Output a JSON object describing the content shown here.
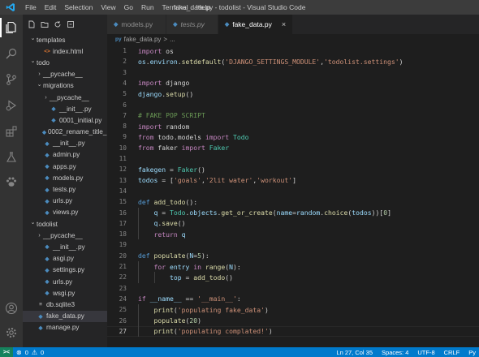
{
  "window": {
    "title": "fake_data.py - todolist - Visual Studio Code",
    "menu": [
      "File",
      "Edit",
      "Selection",
      "View",
      "Go",
      "Run",
      "Terminal",
      "Help"
    ]
  },
  "activity_bar": {
    "top": [
      "explorer-icon",
      "search-icon",
      "source-control-icon",
      "run-debug-icon",
      "extensions-icon",
      "testing-icon",
      "paw-icon"
    ],
    "bottom": [
      "account-icon",
      "settings-gear-icon"
    ]
  },
  "explorer": {
    "items": [
      {
        "label": "templates",
        "kind": "folder",
        "open": true,
        "depth": 1
      },
      {
        "label": "index.html",
        "kind": "html",
        "depth": 2
      },
      {
        "label": "todo",
        "kind": "folder",
        "open": true,
        "depth": 1
      },
      {
        "label": "__pycache__",
        "kind": "folder",
        "open": false,
        "depth": 2
      },
      {
        "label": "migrations",
        "kind": "folder",
        "open": true,
        "depth": 2
      },
      {
        "label": "__pycache__",
        "kind": "folder",
        "open": false,
        "depth": 3
      },
      {
        "label": "__init__.py",
        "kind": "py",
        "depth": 3
      },
      {
        "label": "0001_initial.py",
        "kind": "py",
        "depth": 3
      },
      {
        "label": "0002_rename_title_...",
        "kind": "py",
        "depth": 3
      },
      {
        "label": "__init__.py",
        "kind": "py",
        "depth": 2
      },
      {
        "label": "admin.py",
        "kind": "py",
        "depth": 2
      },
      {
        "label": "apps.py",
        "kind": "py",
        "depth": 2
      },
      {
        "label": "models.py",
        "kind": "py",
        "depth": 2
      },
      {
        "label": "tests.py",
        "kind": "py",
        "depth": 2
      },
      {
        "label": "urls.py",
        "kind": "py",
        "depth": 2
      },
      {
        "label": "views.py",
        "kind": "py",
        "depth": 2
      },
      {
        "label": "todolist",
        "kind": "folder",
        "open": true,
        "depth": 1
      },
      {
        "label": "__pycache__",
        "kind": "folder",
        "open": false,
        "depth": 2
      },
      {
        "label": "__init__.py",
        "kind": "py",
        "depth": 2
      },
      {
        "label": "asgi.py",
        "kind": "py",
        "depth": 2
      },
      {
        "label": "settings.py",
        "kind": "py",
        "depth": 2
      },
      {
        "label": "urls.py",
        "kind": "py",
        "depth": 2
      },
      {
        "label": "wsgi.py",
        "kind": "py",
        "depth": 2
      },
      {
        "label": "db.sqlite3",
        "kind": "db",
        "depth": 1
      },
      {
        "label": "fake_data.py",
        "kind": "py",
        "depth": 1,
        "selected": true
      },
      {
        "label": "manage.py",
        "kind": "py",
        "depth": 1
      }
    ]
  },
  "tabs": [
    {
      "label": "models.py",
      "active": false,
      "italic": false
    },
    {
      "label": "tests.py",
      "active": false,
      "italic": true
    },
    {
      "label": "fake_data.py",
      "active": true,
      "italic": false,
      "close": "×"
    }
  ],
  "breadcrumb": {
    "file": "fake_data.py",
    "sep": ">",
    "rest": "..."
  },
  "editor": {
    "current_line": 27,
    "lines": [
      {
        "n": 1,
        "t": [
          [
            "import",
            "kw"
          ],
          [
            " os",
            "plain"
          ]
        ]
      },
      {
        "n": 2,
        "t": [
          [
            "os",
            "var"
          ],
          [
            ".",
            "plain"
          ],
          [
            "environ",
            "var"
          ],
          [
            ".",
            "plain"
          ],
          [
            "setdefault",
            "fn"
          ],
          [
            "(",
            "plain"
          ],
          [
            "'DJANGO_SETTINGS_MODULE'",
            "str"
          ],
          [
            ",",
            "plain"
          ],
          [
            "'todolist.settings'",
            "str"
          ],
          [
            ")",
            "plain"
          ]
        ]
      },
      {
        "n": 3,
        "t": []
      },
      {
        "n": 4,
        "t": [
          [
            "import",
            "kw"
          ],
          [
            " django",
            "plain"
          ]
        ]
      },
      {
        "n": 5,
        "t": [
          [
            "django",
            "var"
          ],
          [
            ".",
            "plain"
          ],
          [
            "setup",
            "fn"
          ],
          [
            "()",
            "plain"
          ]
        ]
      },
      {
        "n": 6,
        "t": []
      },
      {
        "n": 7,
        "t": [
          [
            "# FAKE POP SCRIPT",
            "cmt"
          ]
        ]
      },
      {
        "n": 8,
        "t": [
          [
            "import",
            "kw"
          ],
          [
            " random",
            "plain"
          ]
        ]
      },
      {
        "n": 9,
        "t": [
          [
            "from",
            "kw"
          ],
          [
            " todo.models ",
            "plain"
          ],
          [
            "import",
            "kw"
          ],
          [
            " ",
            "plain"
          ],
          [
            "Todo",
            "cls"
          ]
        ]
      },
      {
        "n": 10,
        "t": [
          [
            "from",
            "kw"
          ],
          [
            " faker ",
            "plain"
          ],
          [
            "import",
            "kw"
          ],
          [
            " ",
            "plain"
          ],
          [
            "Faker",
            "cls"
          ]
        ]
      },
      {
        "n": 11,
        "t": []
      },
      {
        "n": 12,
        "t": [
          [
            "fakegen",
            "var"
          ],
          [
            " = ",
            "plain"
          ],
          [
            "Faker",
            "cls"
          ],
          [
            "()",
            "plain"
          ]
        ]
      },
      {
        "n": 13,
        "t": [
          [
            "todos",
            "var"
          ],
          [
            " = [",
            "plain"
          ],
          [
            "'goals'",
            "str"
          ],
          [
            ",",
            "plain"
          ],
          [
            "'2lit water'",
            "str"
          ],
          [
            ",",
            "plain"
          ],
          [
            "'workout'",
            "str"
          ],
          [
            "]",
            "plain"
          ]
        ]
      },
      {
        "n": 14,
        "t": []
      },
      {
        "n": 15,
        "t": [
          [
            "def",
            "kwb"
          ],
          [
            " ",
            "plain"
          ],
          [
            "add_todo",
            "fn"
          ],
          [
            "():",
            "plain"
          ]
        ]
      },
      {
        "n": 16,
        "t": [
          [
            "    q",
            "var"
          ],
          [
            " = ",
            "plain"
          ],
          [
            "Todo",
            "cls"
          ],
          [
            ".",
            "plain"
          ],
          [
            "objects",
            "var"
          ],
          [
            ".",
            "plain"
          ],
          [
            "get_or_create",
            "fn"
          ],
          [
            "(",
            "plain"
          ],
          [
            "name",
            "var"
          ],
          [
            "=",
            "plain"
          ],
          [
            "random",
            "var"
          ],
          [
            ".",
            "plain"
          ],
          [
            "choice",
            "fn"
          ],
          [
            "(",
            "plain"
          ],
          [
            "todos",
            "var"
          ],
          [
            "))[",
            "plain"
          ],
          [
            "0",
            "num"
          ],
          [
            "]",
            "plain"
          ]
        ]
      },
      {
        "n": 17,
        "t": [
          [
            "    q",
            "var"
          ],
          [
            ".",
            "plain"
          ],
          [
            "save",
            "fn"
          ],
          [
            "()",
            "plain"
          ]
        ]
      },
      {
        "n": 18,
        "t": [
          [
            "    ",
            "plain"
          ],
          [
            "return",
            "kw"
          ],
          [
            " q",
            "var"
          ]
        ]
      },
      {
        "n": 19,
        "t": []
      },
      {
        "n": 20,
        "t": [
          [
            "def",
            "kwb"
          ],
          [
            " ",
            "plain"
          ],
          [
            "populate",
            "fn"
          ],
          [
            "(",
            "plain"
          ],
          [
            "N",
            "var"
          ],
          [
            "=",
            "plain"
          ],
          [
            "5",
            "num"
          ],
          [
            "):",
            "plain"
          ]
        ]
      },
      {
        "n": 21,
        "t": [
          [
            "    ",
            "plain"
          ],
          [
            "for",
            "kw"
          ],
          [
            " entry ",
            "var"
          ],
          [
            "in",
            "kw"
          ],
          [
            " ",
            "plain"
          ],
          [
            "range",
            "fn"
          ],
          [
            "(",
            "plain"
          ],
          [
            "N",
            "var"
          ],
          [
            "):",
            "plain"
          ]
        ]
      },
      {
        "n": 22,
        "t": [
          [
            "        top",
            "var"
          ],
          [
            " = ",
            "plain"
          ],
          [
            "add_todo",
            "fn"
          ],
          [
            "()",
            "plain"
          ]
        ]
      },
      {
        "n": 23,
        "t": []
      },
      {
        "n": 24,
        "t": [
          [
            "if",
            "kw"
          ],
          [
            " ",
            "plain"
          ],
          [
            "__name__",
            "var"
          ],
          [
            " == ",
            "plain"
          ],
          [
            "'__main__'",
            "str"
          ],
          [
            ":",
            "plain"
          ]
        ]
      },
      {
        "n": 25,
        "t": [
          [
            "    ",
            "plain"
          ],
          [
            "print",
            "fn"
          ],
          [
            "(",
            "plain"
          ],
          [
            "'populating fake_data'",
            "str"
          ],
          [
            ")",
            "plain"
          ]
        ]
      },
      {
        "n": 26,
        "t": [
          [
            "    ",
            "plain"
          ],
          [
            "populate",
            "fn"
          ],
          [
            "(",
            "plain"
          ],
          [
            "20",
            "num"
          ],
          [
            ")",
            "plain"
          ]
        ]
      },
      {
        "n": 27,
        "t": [
          [
            "    ",
            "plain"
          ],
          [
            "print",
            "fn"
          ],
          [
            "(",
            "plain"
          ],
          [
            "'populating complated!'",
            "str"
          ],
          [
            ")",
            "plain"
          ]
        ]
      }
    ]
  },
  "statusbar": {
    "remote": "><",
    "errors": "0",
    "warnings": "0",
    "position": "Ln 27, Col 35",
    "spaces": "Spaces: 4",
    "encoding": "UTF-8",
    "eol": "CRLF",
    "language": "Py"
  },
  "colors": {
    "accent": "#007acc",
    "titlebar": "#3c3c3c",
    "activity": "#333333",
    "sidebar": "#252526",
    "editor": "#1e1e1e"
  }
}
